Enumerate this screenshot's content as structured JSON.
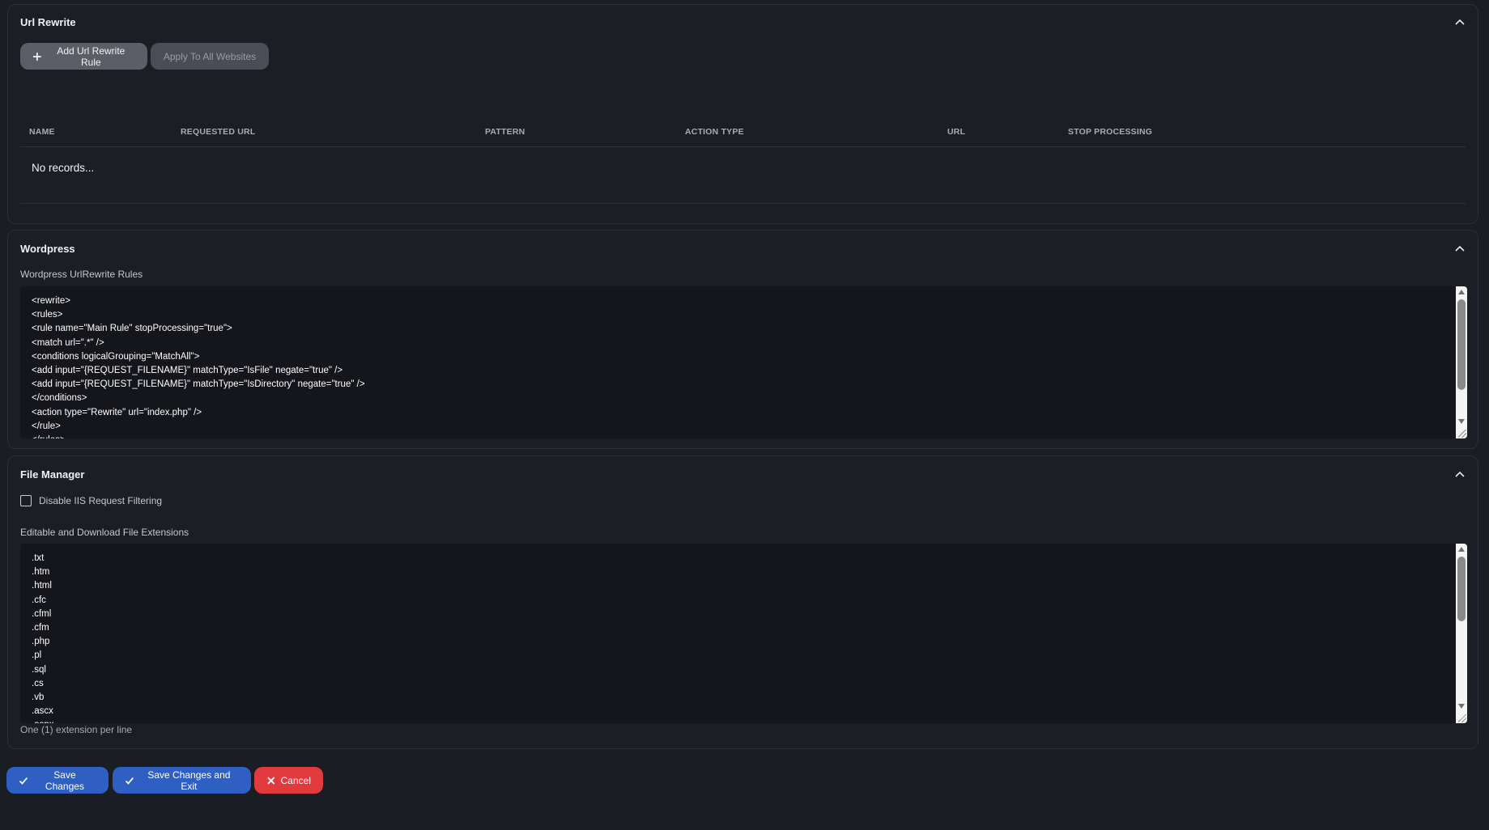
{
  "url_rewrite": {
    "title": "Url Rewrite",
    "add_button": "Add Url Rewrite Rule",
    "apply_button": "Apply To All Websites",
    "columns": [
      "NAME",
      "REQUESTED URL",
      "PATTERN",
      "ACTION TYPE",
      "URL",
      "STOP PROCESSING"
    ],
    "empty_text": "No records..."
  },
  "wordpress": {
    "title": "Wordpress",
    "field_label": "Wordpress UrlRewrite Rules",
    "lines": [
      "<rewrite>",
      "<rules>",
      "<rule name=\"Main Rule\" stopProcessing=\"true\">",
      "<match url=\".*\" />",
      "<conditions logicalGrouping=\"MatchAll\">",
      "<add input=\"{REQUEST_FILENAME}\" matchType=\"IsFile\" negate=\"true\" />",
      "<add input=\"{REQUEST_FILENAME}\" matchType=\"IsDirectory\" negate=\"true\" />",
      "</conditions>",
      "<action type=\"Rewrite\" url=\"index.php\" />",
      "</rule>",
      "</rules>"
    ]
  },
  "file_manager": {
    "title": "File Manager",
    "checkbox_label": "Disable IIS Request Filtering",
    "field_label": "Editable and Download File Extensions",
    "extensions": [
      ".txt",
      ".htm",
      ".html",
      ".cfc",
      ".cfml",
      ".cfm",
      ".php",
      ".pl",
      ".sql",
      ".cs",
      ".vb",
      ".ascx",
      ".aspx"
    ],
    "hint": "One (1) extension per line"
  },
  "footer": {
    "save": "Save Changes",
    "save_exit": "Save Changes and Exit",
    "cancel": "Cancel"
  }
}
